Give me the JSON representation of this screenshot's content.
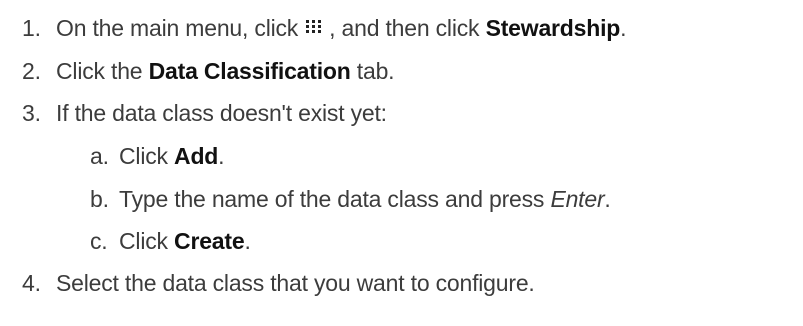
{
  "steps": [
    {
      "number": "1.",
      "before": "On the main menu, click",
      "icon": "grid-menu-icon",
      "middle": ", and then click",
      "bold": "Stewardship",
      "after": "."
    },
    {
      "number": "2.",
      "before": "Click the",
      "bold": "Data Classification",
      "after": " tab."
    },
    {
      "number": "3.",
      "text": "If the data class doesn't exist yet:"
    },
    {
      "number": "a.",
      "before": "Click",
      "bold": "Add",
      "after": "."
    },
    {
      "number": "b.",
      "before": "Type the name of the data class and press",
      "italic": "Enter",
      "after": "."
    },
    {
      "number": "c.",
      "before": "Click",
      "bold": "Create",
      "after": "."
    },
    {
      "number": "4.",
      "text": "Select the data class that you want to configure."
    }
  ],
  "colors": {
    "text": "#3c3c3c",
    "emphasis": "#111111",
    "background": "#ffffff"
  }
}
